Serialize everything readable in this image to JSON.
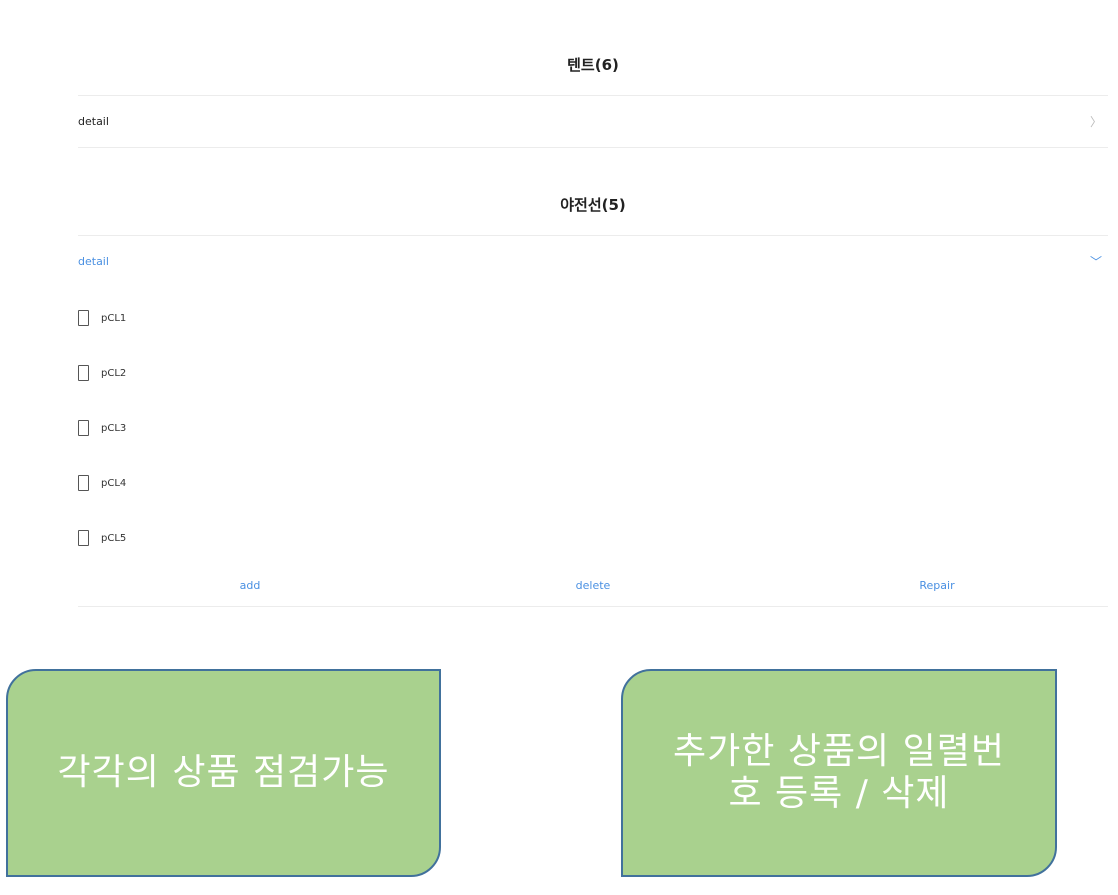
{
  "groups": [
    {
      "title": "텐트(6)",
      "detail_label": "detail",
      "chevron": "〉",
      "expanded": false
    },
    {
      "title": "야전선(5)",
      "detail_label": "detail",
      "chevron": "﹀",
      "expanded": true,
      "items": [
        "pCL1",
        "pCL2",
        "pCL3",
        "pCL4",
        "pCL5"
      ]
    }
  ],
  "actions": {
    "add": "add",
    "delete": "delete",
    "repair": "Repair"
  },
  "callouts": {
    "left": "각각의 상품 점검가능",
    "right": "추가한 상품의 일렬번호 등록 / 삭제"
  },
  "colors": {
    "link_blue": "#4a90e2",
    "callout_fill": "#a9d18e",
    "callout_border": "#41719c"
  }
}
